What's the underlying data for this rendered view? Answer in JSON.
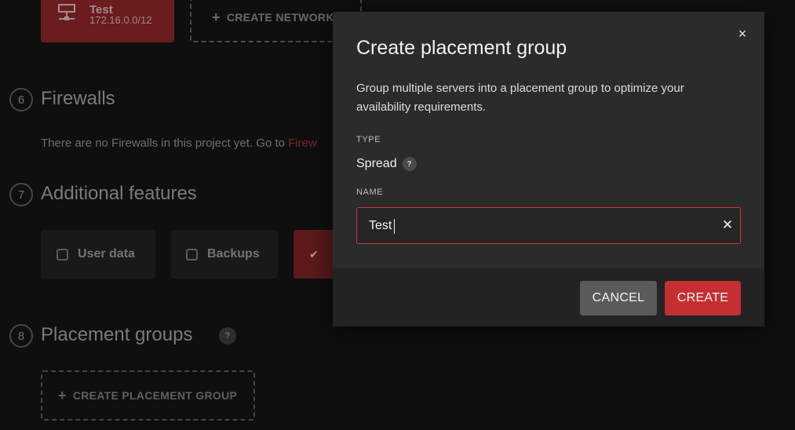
{
  "background": {
    "network_card": {
      "name": "Test",
      "cidr": "172.16.0.0/12"
    },
    "create_network_label": "CREATE NETWORK",
    "sections": {
      "firewalls": {
        "number": "6",
        "title": "Firewalls",
        "text_prefix": "There are no Firewalls in this project yet. Go to ",
        "link_text": "Firew"
      },
      "additional_features": {
        "number": "7",
        "title": "Additional features"
      },
      "placement_groups": {
        "number": "8",
        "title": "Placement groups",
        "help": "?",
        "create_label": "CREATE PLACEMENT GROUP"
      }
    },
    "features": [
      {
        "label": "User data",
        "checked": false
      },
      {
        "label": "Backups",
        "checked": false
      },
      {
        "label": "",
        "checked": true
      }
    ]
  },
  "modal": {
    "title": "Create placement group",
    "description": "Group multiple servers into a placement group to optimize your availability requirements.",
    "close_glyph": "×",
    "type": {
      "label": "TYPE",
      "value": "Spread",
      "help": "?"
    },
    "name": {
      "label": "NAME",
      "value": "Test",
      "clear_glyph": "✕"
    },
    "buttons": {
      "cancel": "CANCEL",
      "create": "CREATE"
    }
  },
  "colors": {
    "accent": "#c52f33",
    "modal_bg": "#2b2b2b",
    "footer_bg": "#232323",
    "cancel_bg": "#5a5a5a"
  }
}
